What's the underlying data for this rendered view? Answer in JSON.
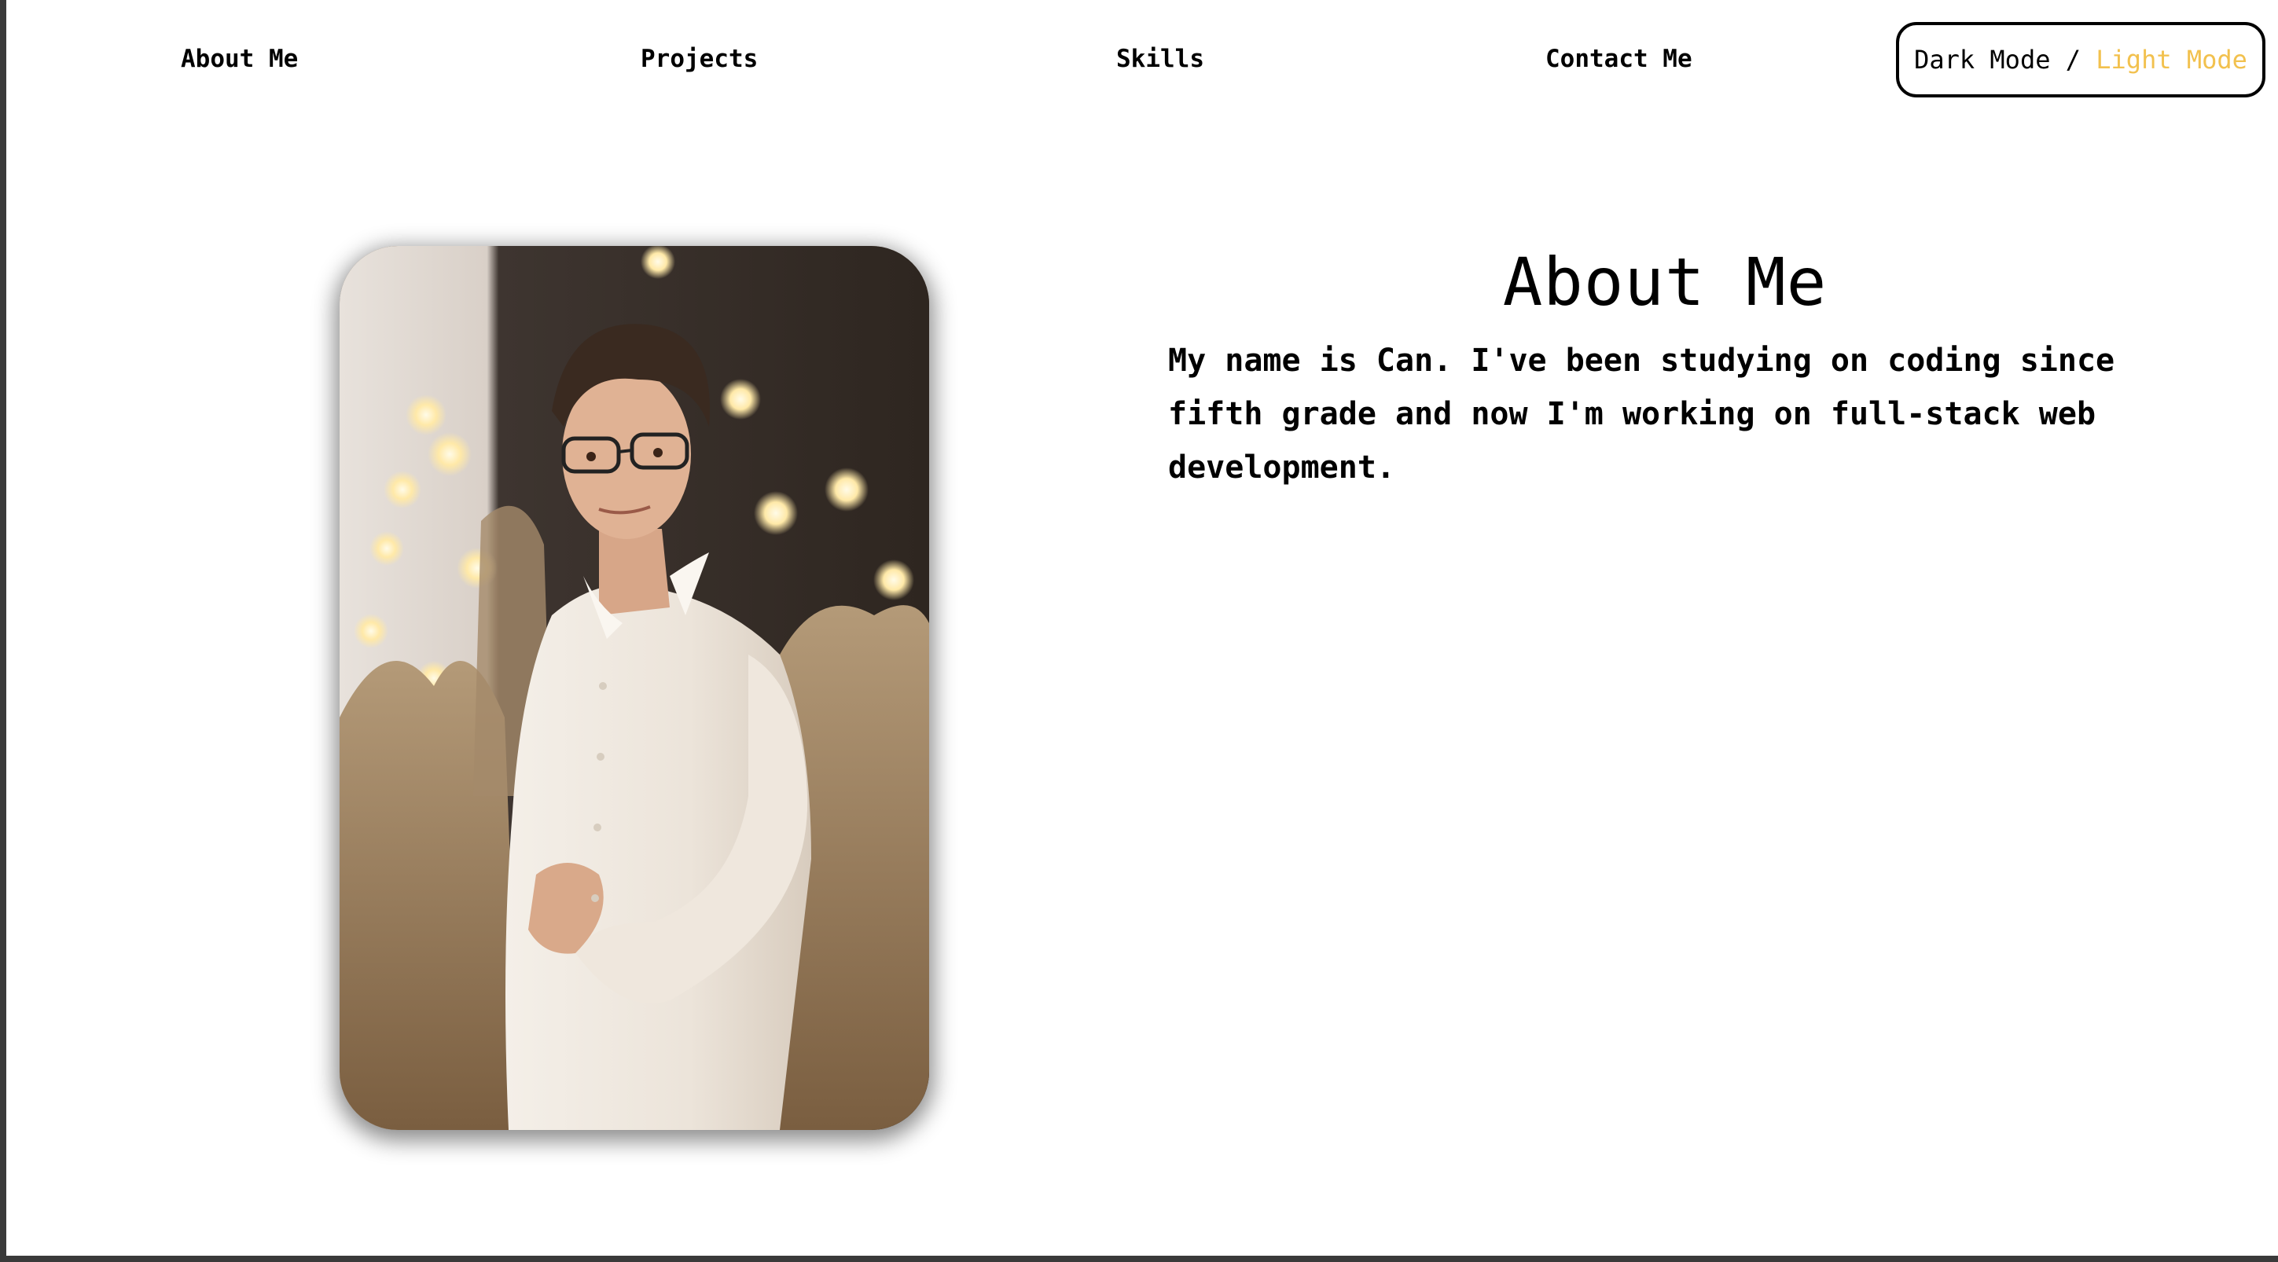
{
  "nav": {
    "items": [
      {
        "label": "About Me"
      },
      {
        "label": "Projects"
      },
      {
        "label": "Skills"
      },
      {
        "label": "Contact Me"
      }
    ],
    "mode_toggle": {
      "dark_label": "Dark Mode",
      "separator": " / ",
      "light_label": "Light Mode",
      "active_color": "#f2c14e"
    }
  },
  "about": {
    "title": "About Me",
    "body": "My name is Can. I've been studying on coding since fifth grade and now I'm working on full-stack web development."
  },
  "photo": {
    "icon": "portrait-photo"
  },
  "colors": {
    "background": "#ffffff",
    "text": "#000000",
    "accent": "#f2c14e",
    "frame": "#3a3a3a"
  }
}
